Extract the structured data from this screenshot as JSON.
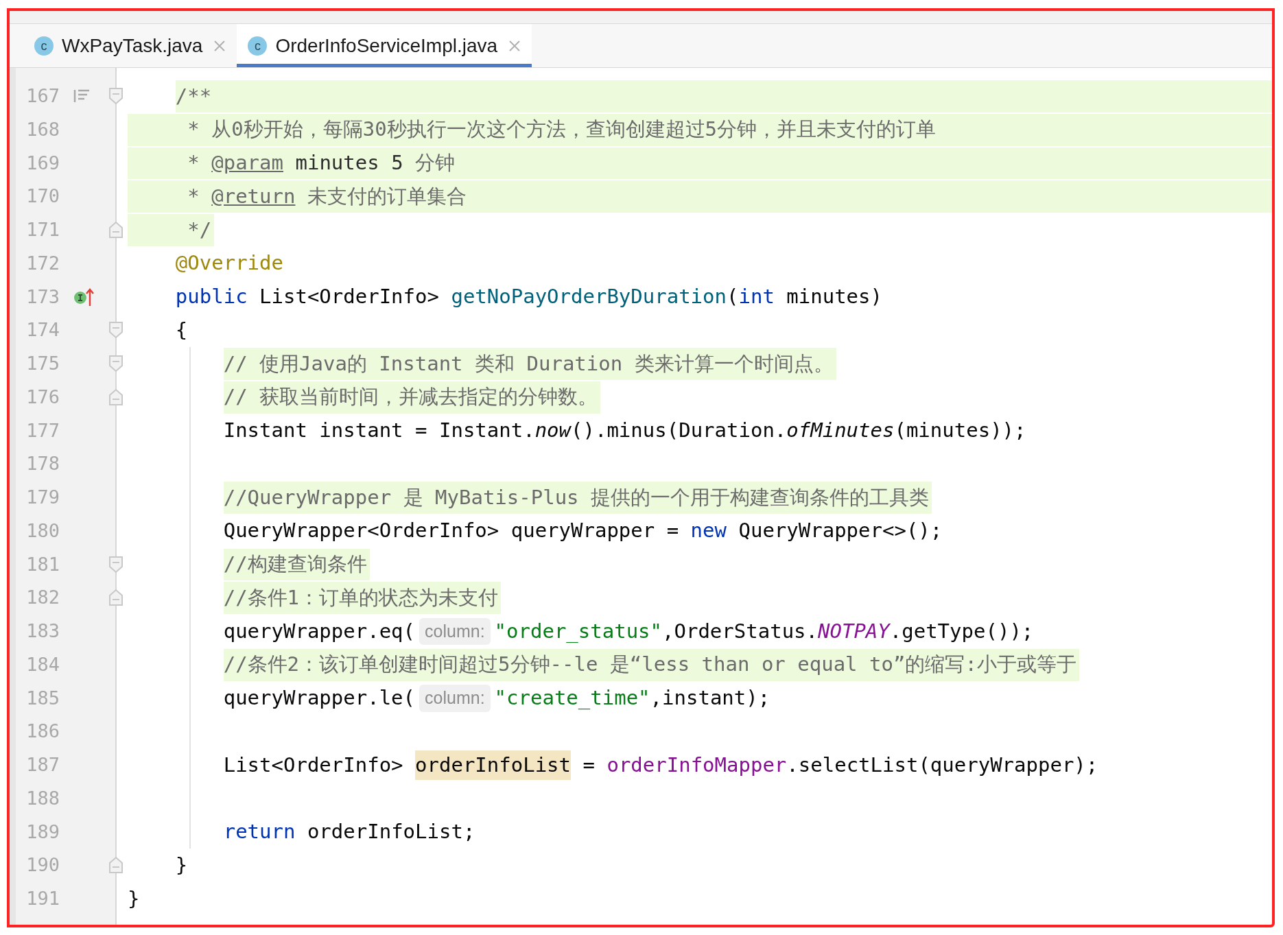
{
  "tabs": [
    {
      "icon_letter": "c",
      "label": "WxPayTask.java",
      "selected": false
    },
    {
      "icon_letter": "c",
      "label": "OrderInfoServiceImpl.java",
      "selected": true
    }
  ],
  "lines": [
    {
      "number": "167",
      "gutter_icon": {
        "kind": "params"
      },
      "fold": {
        "kind": "start"
      },
      "highlight": {
        "kind": "doc-start"
      },
      "indent_guide": false,
      "tokens": [
        {
          "kind": "comment",
          "text": "    /**"
        }
      ]
    },
    {
      "number": "168",
      "highlight": {
        "kind": "doc"
      },
      "indent_guide": false,
      "tokens": [
        {
          "kind": "comment",
          "text": "     * 从0秒开始，每隔30秒执行一次这个方法，查询创建超过5分钟，并且未支付的订单"
        }
      ]
    },
    {
      "number": "169",
      "highlight": {
        "kind": "doc"
      },
      "indent_guide": false,
      "tokens": [
        {
          "kind": "comment",
          "text": "     * "
        },
        {
          "kind": "doc-tag",
          "text": "@param"
        },
        {
          "kind": "doc-param",
          "text": " minutes 5 "
        },
        {
          "kind": "comment",
          "text": "分钟"
        }
      ]
    },
    {
      "number": "170",
      "highlight": {
        "kind": "doc"
      },
      "indent_guide": false,
      "tokens": [
        {
          "kind": "comment",
          "text": "     * "
        },
        {
          "kind": "doc-tag",
          "text": "@return"
        },
        {
          "kind": "comment",
          "text": " 未支付的订单集合"
        }
      ]
    },
    {
      "number": "171",
      "fold": {
        "kind": "end"
      },
      "highlight": {
        "kind": "doc-end"
      },
      "indent_guide": false,
      "tokens": [
        {
          "kind": "comment",
          "text": "     */"
        }
      ]
    },
    {
      "number": "172",
      "indent_guide": false,
      "tokens": [
        {
          "kind": "annotation",
          "text": "    @Override"
        }
      ]
    },
    {
      "number": "173",
      "gutter_icon": {
        "kind": "implements"
      },
      "indent_guide": false,
      "tokens": [
        {
          "kind": "keyword",
          "text": "    public"
        },
        {
          "kind": "plain",
          "text": " List<OrderInfo> "
        },
        {
          "kind": "method",
          "text": "getNoPayOrderByDuration"
        },
        {
          "kind": "plain",
          "text": "("
        },
        {
          "kind": "keyword",
          "text": "int"
        },
        {
          "kind": "plain",
          "text": " minutes)"
        }
      ]
    },
    {
      "number": "174",
      "fold": {
        "kind": "start"
      },
      "indent_guide": false,
      "tokens": [
        {
          "kind": "plain",
          "text": "    {"
        }
      ]
    },
    {
      "number": "175",
      "fold": {
        "kind": "start"
      },
      "highlight": {
        "kind": "inline"
      },
      "indent_guide": true,
      "tokens": [
        {
          "kind": "comment",
          "text": "        // 使用Java的 Instant 类和 Duration 类来计算一个时间点。"
        }
      ]
    },
    {
      "number": "176",
      "fold": {
        "kind": "end"
      },
      "highlight": {
        "kind": "inline"
      },
      "indent_guide": true,
      "tokens": [
        {
          "kind": "comment",
          "text": "        // 获取当前时间，并减去指定的分钟数。"
        }
      ]
    },
    {
      "number": "177",
      "indent_guide": true,
      "tokens": [
        {
          "kind": "plain",
          "text": "        Instant instant = Instant."
        },
        {
          "kind": "italic",
          "text": "now"
        },
        {
          "kind": "plain",
          "text": "().minus(Duration."
        },
        {
          "kind": "italic",
          "text": "ofMinutes"
        },
        {
          "kind": "plain",
          "text": "(minutes));"
        }
      ]
    },
    {
      "number": "178",
      "indent_guide": true
    },
    {
      "number": "179",
      "highlight": {
        "kind": "inline"
      },
      "indent_guide": true,
      "tokens": [
        {
          "kind": "comment",
          "text": "        //QueryWrapper 是 MyBatis-Plus 提供的一个用于构建查询条件的工具类"
        }
      ]
    },
    {
      "number": "180",
      "indent_guide": true,
      "tokens": [
        {
          "kind": "plain",
          "text": "        QueryWrapper<OrderInfo> queryWrapper = "
        },
        {
          "kind": "keyword",
          "text": "new"
        },
        {
          "kind": "plain",
          "text": " QueryWrapper<>();"
        }
      ]
    },
    {
      "number": "181",
      "fold": {
        "kind": "start"
      },
      "highlight": {
        "kind": "inline"
      },
      "indent_guide": true,
      "tokens": [
        {
          "kind": "comment",
          "text": "        //构建查询条件"
        }
      ]
    },
    {
      "number": "182",
      "fold": {
        "kind": "end"
      },
      "highlight": {
        "kind": "inline"
      },
      "indent_guide": true,
      "tokens": [
        {
          "kind": "comment",
          "text": "        //条件1：订单的状态为未支付"
        }
      ]
    },
    {
      "number": "183",
      "indent_guide": true,
      "tokens": [
        {
          "kind": "plain",
          "text": "        queryWrapper.eq("
        },
        {
          "kind": "hint",
          "text": "column:"
        },
        {
          "kind": "string",
          "text": "\"order_status\""
        },
        {
          "kind": "plain",
          "text": ",OrderStatus."
        },
        {
          "kind": "constant",
          "text": "NOTPAY"
        },
        {
          "kind": "plain",
          "text": ".getType());"
        }
      ]
    },
    {
      "number": "184",
      "highlight": {
        "kind": "inline"
      },
      "indent_guide": true,
      "tokens": [
        {
          "kind": "comment",
          "text": "        //条件2：该订单创建时间超过5分钟--le 是“less than or equal to”的缩写:小于或等于"
        }
      ]
    },
    {
      "number": "185",
      "indent_guide": true,
      "tokens": [
        {
          "kind": "plain",
          "text": "        queryWrapper.le("
        },
        {
          "kind": "hint",
          "text": "column:"
        },
        {
          "kind": "string",
          "text": "\"create_time\""
        },
        {
          "kind": "plain",
          "text": ",instant);"
        }
      ]
    },
    {
      "number": "186",
      "indent_guide": true
    },
    {
      "number": "187",
      "indent_guide": true,
      "tokens": [
        {
          "kind": "plain",
          "text": "        List<OrderInfo> "
        },
        {
          "kind": "usage",
          "text": "orderInfoList"
        },
        {
          "kind": "plain",
          "text": " = "
        },
        {
          "kind": "field",
          "text": "orderInfoMapper"
        },
        {
          "kind": "plain",
          "text": ".selectList(queryWrapper);"
        }
      ]
    },
    {
      "number": "188",
      "indent_guide": true
    },
    {
      "number": "189",
      "indent_guide": true,
      "tokens": [
        {
          "kind": "keyword",
          "text": "        return"
        },
        {
          "kind": "plain",
          "text": " orderInfoList;"
        }
      ]
    },
    {
      "number": "190",
      "fold": {
        "kind": "end"
      },
      "indent_guide": false,
      "tokens": [
        {
          "kind": "plain",
          "text": "    }"
        }
      ]
    },
    {
      "number": "191",
      "indent_guide": false,
      "tokens": [
        {
          "kind": "plain",
          "text": "}"
        }
      ]
    }
  ]
}
